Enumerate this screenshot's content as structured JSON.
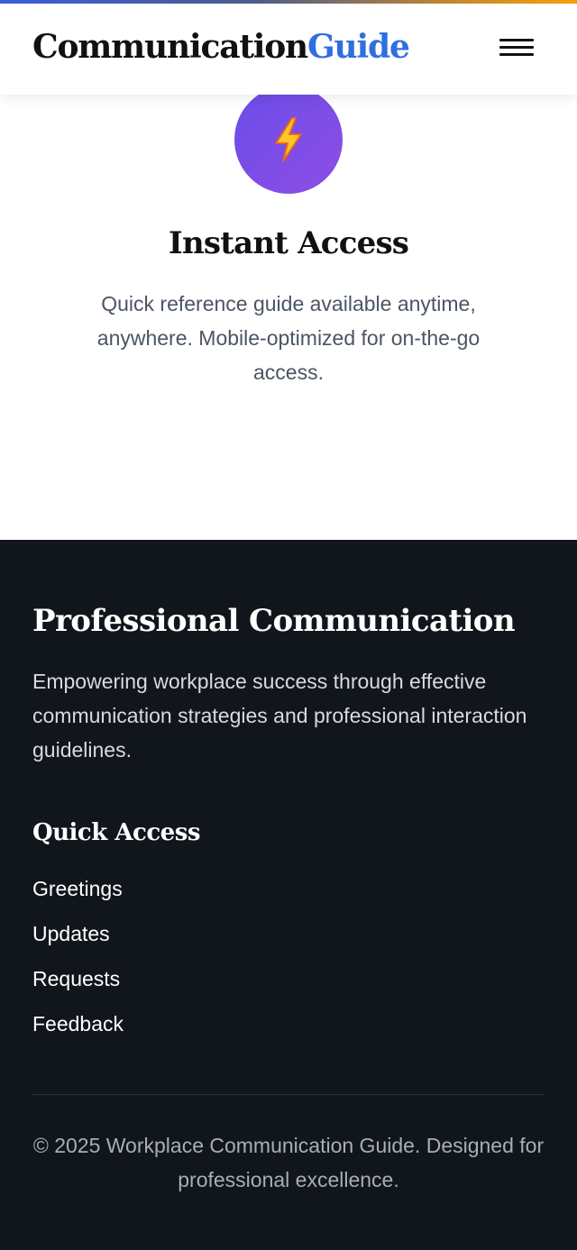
{
  "header": {
    "logo_primary": "Communication",
    "logo_accent": "Guide",
    "menu_icon": "hamburger-menu-icon"
  },
  "feature": {
    "icon": "lightning-icon",
    "title": "Instant Access",
    "description": "Quick reference guide available anytime, anywhere. Mobile-optimized for on-the-go access."
  },
  "footer": {
    "title": "Professional Communication",
    "description": "Empowering workplace success through effective communication strategies and professional interaction guidelines.",
    "quick_access_title": "Quick Access",
    "links": [
      "Greetings",
      "Updates",
      "Requests",
      "Feedback"
    ],
    "copyright": "© 2025 Workplace Communication Guide. Designed for professional excellence."
  },
  "colors": {
    "accent_blue": "#2f6fde",
    "feature_circle": "#7b4de8",
    "footer_bg": "#11151c"
  }
}
